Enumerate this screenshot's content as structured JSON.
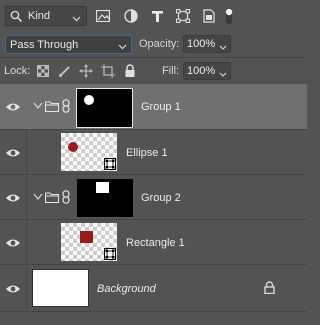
{
  "filter": {
    "kind_label": "Kind",
    "icons": [
      "image-filter-icon",
      "adjustment-filter-icon",
      "type-filter-icon",
      "shape-filter-icon",
      "smart-object-filter-icon",
      "filter-toggle-icon"
    ]
  },
  "blend": {
    "mode": "Pass Through",
    "opacity_label": "Opacity:",
    "opacity_value": "100%"
  },
  "lock": {
    "label": "Lock:",
    "fill_label": "Fill:",
    "fill_value": "100%"
  },
  "layers": [
    {
      "name": "Group 1",
      "type": "group",
      "selected": true,
      "mask_shape": "circle"
    },
    {
      "name": "Ellipse 1",
      "type": "shape",
      "shape": "circle",
      "color": "#9b1b1b"
    },
    {
      "name": "Group 2",
      "type": "group",
      "selected": false,
      "mask_shape": "square"
    },
    {
      "name": "Rectangle 1",
      "type": "shape",
      "shape": "rect",
      "color": "#9b1b1b"
    },
    {
      "name": "Background",
      "type": "background",
      "locked": true
    }
  ],
  "colors": {
    "panel_bg": "#535353",
    "selected_bg": "#707070",
    "shape_red": "#9b1b1b",
    "focus_blue": "#3a6a9e"
  }
}
